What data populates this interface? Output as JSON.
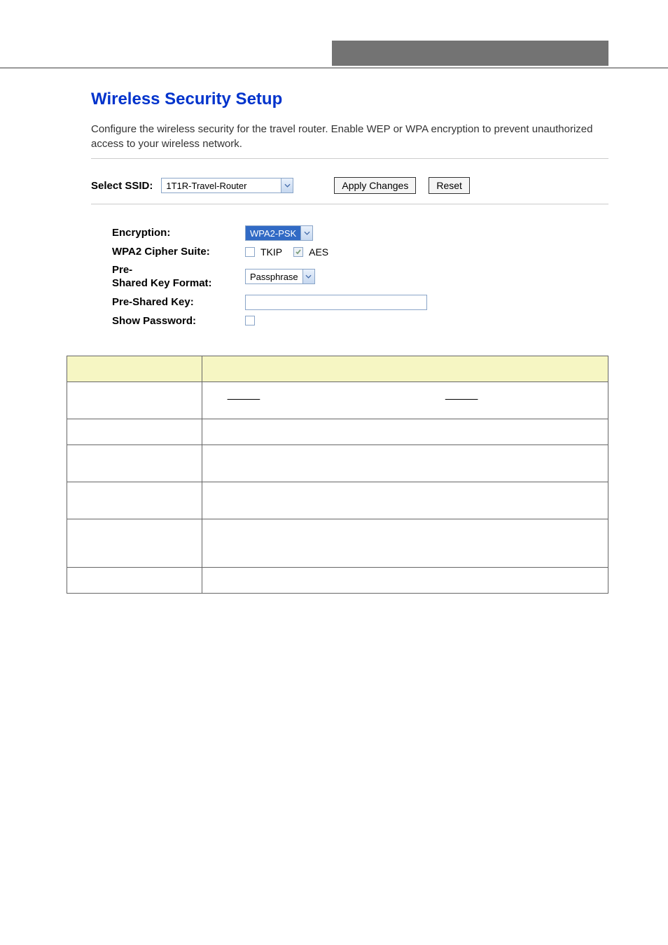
{
  "page": {
    "title": "Wireless Security Setup",
    "description": "Configure the wireless security for the travel router. Enable WEP or WPA encryption to prevent unauthorized access to your wireless network."
  },
  "ssid_row": {
    "label": "Select SSID:",
    "selected": "1T1R-Travel-Router",
    "apply_label": "Apply Changes",
    "reset_label": "Reset"
  },
  "form": {
    "encryption_label": "Encryption:",
    "encryption_value": "WPA2-PSK",
    "cipher_label": "WPA2 Cipher Suite:",
    "cipher_tkip": "TKIP",
    "cipher_aes": "AES",
    "cipher_tkip_checked": false,
    "cipher_aes_checked": true,
    "key_format_label": "Pre-Shared Key Format:",
    "key_format_value": "Passphrase",
    "psk_label": "Pre-Shared Key:",
    "psk_value": "",
    "show_pw_label": "Show Password:",
    "show_pw_checked": false
  }
}
